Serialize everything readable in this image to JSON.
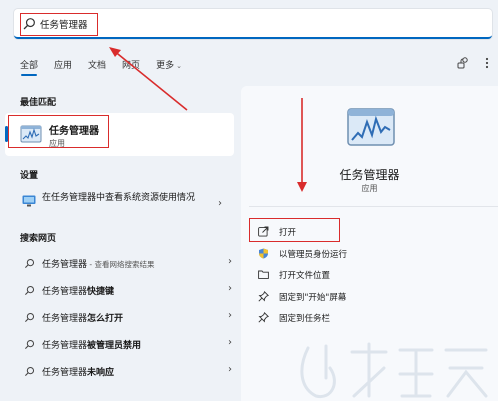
{
  "search": {
    "query": "任务管理器"
  },
  "tabs": [
    {
      "label": "全部"
    },
    {
      "label": "应用"
    },
    {
      "label": "文档"
    },
    {
      "label": "网页"
    },
    {
      "label": "更多"
    }
  ],
  "best_match": {
    "title": "最佳匹配",
    "name": "任务管理器",
    "type": "应用"
  },
  "settings": {
    "title": "设置",
    "item": "在任务管理器中查看系统资源使用情况"
  },
  "web": {
    "title": "搜索网页",
    "items": [
      {
        "prefix": "任务管理器",
        "bold": "",
        "suffix": " - 查看网络搜索结果"
      },
      {
        "prefix": "任务管理器",
        "bold": "快捷键",
        "suffix": ""
      },
      {
        "prefix": "任务管理器",
        "bold": "怎么打开",
        "suffix": ""
      },
      {
        "prefix": "任务管理器",
        "bold": "被管理员禁用",
        "suffix": ""
      },
      {
        "prefix": "任务管理器",
        "bold": "未响应",
        "suffix": ""
      }
    ]
  },
  "detail": {
    "name": "任务管理器",
    "type": "应用",
    "actions": [
      {
        "label": "打开",
        "icon": "open-external-icon"
      },
      {
        "label": "以管理员身份运行",
        "icon": "shield-icon"
      },
      {
        "label": "打开文件位置",
        "icon": "folder-icon"
      },
      {
        "label": "固定到\"开始\"屏幕",
        "icon": "pin-icon"
      },
      {
        "label": "固定到任务栏",
        "icon": "pin-icon"
      }
    ]
  },
  "colors": {
    "accent": "#0067c0",
    "annotation": "#d92c2c"
  }
}
